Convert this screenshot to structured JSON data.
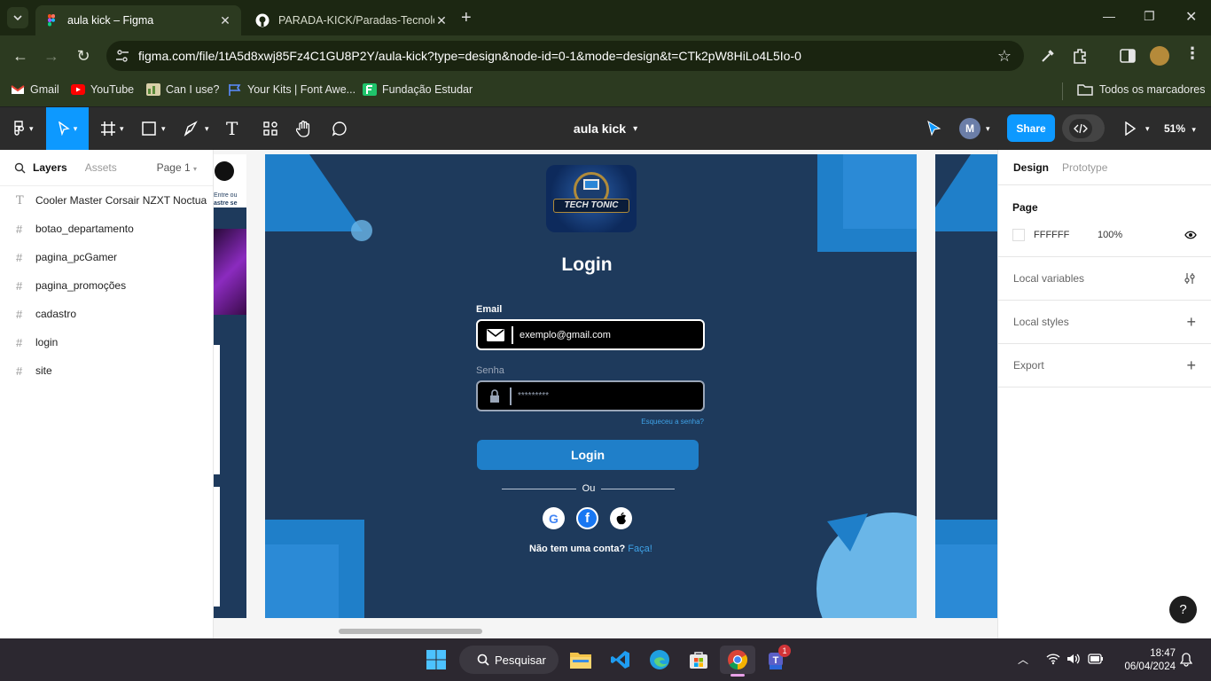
{
  "browser": {
    "tabs": [
      {
        "title": "aula kick – Figma",
        "active": true
      },
      {
        "title": "PARADA-KICK/Paradas-Tecnolo",
        "active": false
      }
    ],
    "url": "figma.com/file/1tA5d8xwj85Fz4C1GU8P2Y/aula-kick?type=design&node-id=0-1&mode=design&t=CTk2pW8HiLo4L5Io-0",
    "bookmarks": [
      {
        "label": "Gmail",
        "icon": "gmail-icon"
      },
      {
        "label": "YouTube",
        "icon": "youtube-icon"
      },
      {
        "label": "Can I use?",
        "icon": "caniuse-icon"
      },
      {
        "label": "Your Kits | Font Awe...",
        "icon": "fontawesome-icon"
      },
      {
        "label": "Fundação Estudar",
        "icon": "fundacao-icon"
      }
    ],
    "all_bookmarks": "Todos os marcadores"
  },
  "figma": {
    "file_title": "aula kick",
    "share_label": "Share",
    "avatar_initial": "M",
    "zoom": "51%",
    "left_panel": {
      "tab_layers": "Layers",
      "tab_assets": "Assets",
      "page_selector": "Page 1",
      "layers": [
        {
          "name": "Cooler Master Corsair NZXT Noctua",
          "type": "text"
        },
        {
          "name": "botao_departamento",
          "type": "frame"
        },
        {
          "name": "pagina_pcGamer",
          "type": "frame"
        },
        {
          "name": "pagina_promoções",
          "type": "frame"
        },
        {
          "name": "cadastro",
          "type": "frame"
        },
        {
          "name": "login",
          "type": "frame"
        },
        {
          "name": "site",
          "type": "frame"
        }
      ]
    },
    "right_panel": {
      "tab_design": "Design",
      "tab_prototype": "Prototype",
      "page_label": "Page",
      "page_color": "FFFFFF",
      "page_opacity": "100%",
      "local_variables": "Local variables",
      "local_styles": "Local styles",
      "export": "Export"
    },
    "help": "?"
  },
  "mockup": {
    "logo_text": "TECH TONIC",
    "title": "Login",
    "email_label": "Email",
    "email_value": "exemplo@gmail.com",
    "password_label": "Senha",
    "password_value": "*********",
    "forgot": "Esqueceu a senha?",
    "login_button": "Login",
    "divider": "Ou",
    "no_account": "Não tem uma conta?",
    "signup_link": "Faça!",
    "side_text_1": "Entre ou",
    "side_text_2": "astre se",
    "colors": {
      "frame_bg": "#1e3a5c",
      "accent": "#1f7fc9",
      "light_blue": "#6ab6e8"
    }
  },
  "taskbar": {
    "search": "Pesquisar",
    "time": "18:47",
    "date": "06/04/2024",
    "teams_badge": "1"
  }
}
